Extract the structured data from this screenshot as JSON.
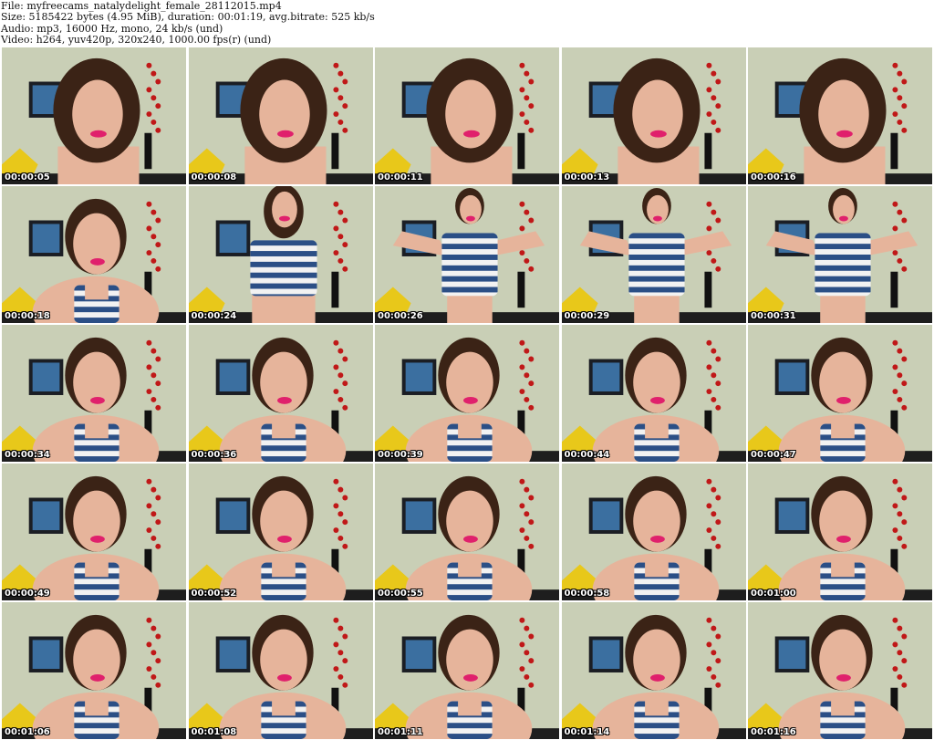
{
  "header": {
    "file_line": "File: myfreecams_natalydelight_female_28112015.mp4",
    "size_line": "Size: 5185422 bytes (4.95 MiB), duration: 00:01:19, avg.bitrate: 525 kb/s",
    "audio_line": "Audio: mp3, 16000 Hz, mono, 24 kb/s (und)",
    "video_line": "Video: h264, yuv420p, 320x240, 1000.00 fps(r) (und)"
  },
  "frames": [
    {
      "time": "00:00:05",
      "pose": "close"
    },
    {
      "time": "00:00:08",
      "pose": "close"
    },
    {
      "time": "00:00:11",
      "pose": "close"
    },
    {
      "time": "00:00:13",
      "pose": "close"
    },
    {
      "time": "00:00:16",
      "pose": "close"
    },
    {
      "time": "00:00:18",
      "pose": "lean"
    },
    {
      "time": "00:00:24",
      "pose": "standing"
    },
    {
      "time": "00:00:26",
      "pose": "arms-up"
    },
    {
      "time": "00:00:29",
      "pose": "arms-up"
    },
    {
      "time": "00:00:31",
      "pose": "arms-up"
    },
    {
      "time": "00:00:34",
      "pose": "lean"
    },
    {
      "time": "00:00:36",
      "pose": "lean"
    },
    {
      "time": "00:00:39",
      "pose": "lean"
    },
    {
      "time": "00:00:44",
      "pose": "lean"
    },
    {
      "time": "00:00:47",
      "pose": "lean"
    },
    {
      "time": "00:00:49",
      "pose": "lean"
    },
    {
      "time": "00:00:52",
      "pose": "lean"
    },
    {
      "time": "00:00:55",
      "pose": "lean"
    },
    {
      "time": "00:00:58",
      "pose": "lean"
    },
    {
      "time": "00:01:00",
      "pose": "lean"
    },
    {
      "time": "00:01:06",
      "pose": "lean"
    },
    {
      "time": "00:01:08",
      "pose": "lean"
    },
    {
      "time": "00:01:11",
      "pose": "lean"
    },
    {
      "time": "00:01:14",
      "pose": "lean"
    },
    {
      "time": "00:01:16",
      "pose": "lean"
    }
  ],
  "colors": {
    "wall": "#c9cfb6",
    "frame_dark": "#1b1e24",
    "picture_blue": "#3b6fa0",
    "pillow": "#e8c81a",
    "flowers": "#c01818",
    "vase": "#111111",
    "skin": "#e6b49b",
    "hair": "#3b2316",
    "lips": "#e0206c",
    "stripe_blue": "#2b4f86",
    "stripe_white": "#f2f2f2",
    "table": "#1e1e1e"
  }
}
